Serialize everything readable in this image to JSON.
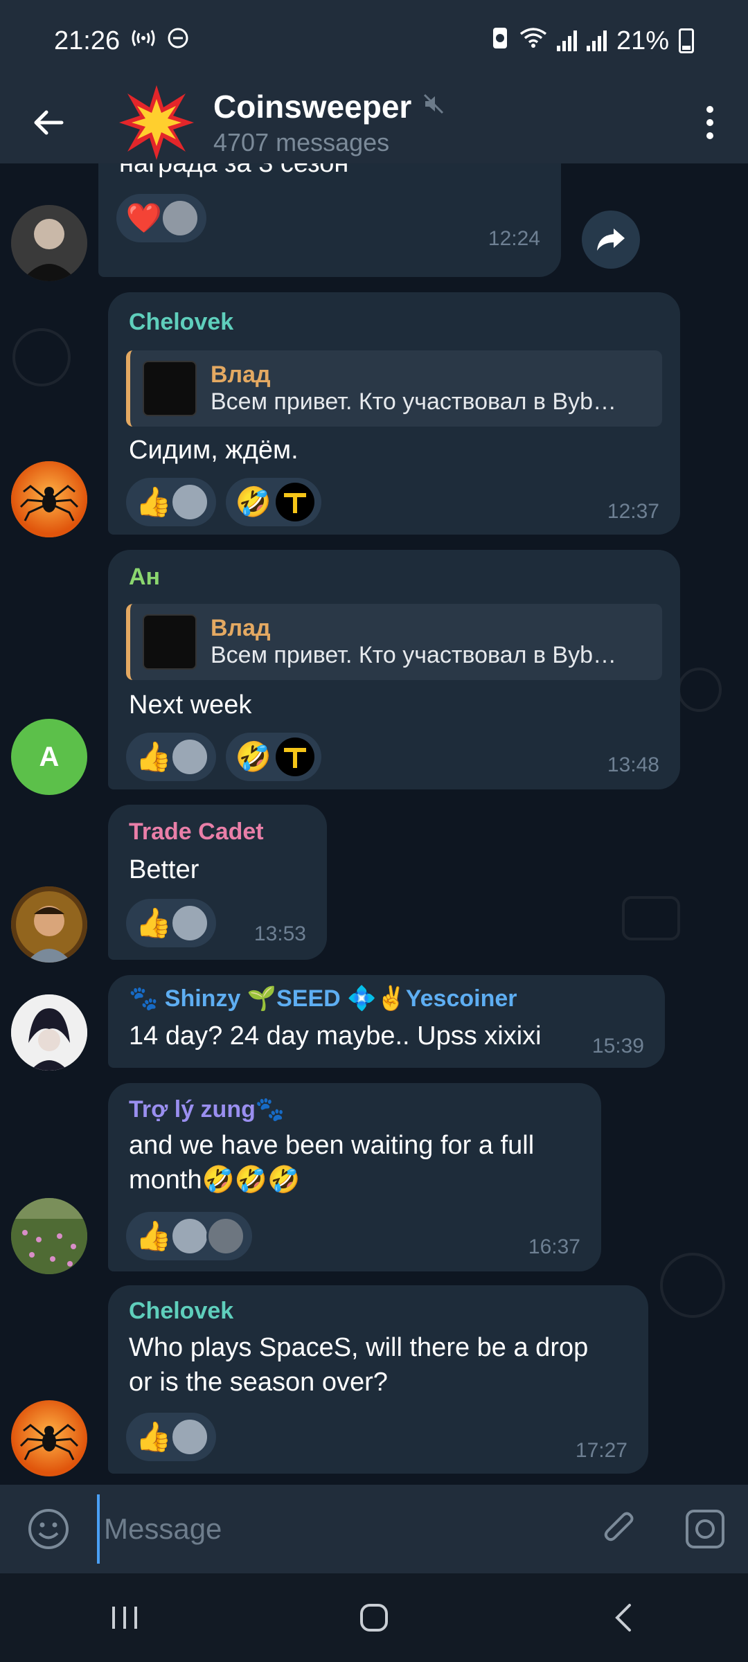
{
  "status_bar": {
    "time": "21:26",
    "battery": "21%"
  },
  "header": {
    "title": "Coinsweeper",
    "subtitle": "4707 messages"
  },
  "messages": [
    {
      "text": "награда за 3 сезон",
      "time": "12:24",
      "reactions": [
        {
          "emoji": "❤️"
        }
      ]
    },
    {
      "sender": "Chelovek",
      "reply_name": "Влад",
      "reply_text": "Всем привет. Кто участвовал в Byb…",
      "text": "Сидим, ждём.",
      "time": "12:37",
      "reactions": [
        {
          "emoji": "👍"
        },
        {
          "emoji": "🤣"
        }
      ]
    },
    {
      "sender": "Ан",
      "reply_name": "Влад",
      "reply_text": "Всем привет. Кто участвовал в Byb…",
      "text": "Next week",
      "time": "13:48",
      "avatar_letter": "A",
      "reactions": [
        {
          "emoji": "👍"
        },
        {
          "emoji": "🤣"
        }
      ]
    },
    {
      "sender": "Trade Cadet",
      "text": "Better",
      "time": "13:53",
      "reactions": [
        {
          "emoji": "👍"
        }
      ]
    },
    {
      "sender": "🐾 Shinzy 🌱SEED 💠✌️Yescoiner",
      "text": "14 day? 24 day maybe.. Upss xixixi",
      "time": "15:39"
    },
    {
      "sender": "Trợ lý zung🐾",
      "text_line1": "and we have been waiting for a full",
      "text_line2": "month🤣🤣🤣",
      "time": "16:37",
      "reactions": [
        {
          "emoji": "👍"
        }
      ]
    },
    {
      "sender": "Chelovek",
      "text_line1": "Who plays SpaceS, will there be a drop",
      "text_line2": "or is the season over?",
      "time": "17:27",
      "reactions": [
        {
          "emoji": "👍"
        }
      ]
    }
  ],
  "input": {
    "placeholder": "Message"
  },
  "colors": {
    "chelovek": "#5fcfbc",
    "an": "#8bd66f",
    "trade_cadet": "#e97fa8",
    "shinzy": "#5eaef2",
    "tro_ly": "#9a8ff0",
    "reply_accent": "#e4a962"
  },
  "icons": [
    "back-arrow-icon",
    "explosion-icon",
    "mute-icon",
    "more-vert-icon",
    "share-icon",
    "emoji-icon",
    "attach-icon",
    "camera-icon"
  ]
}
